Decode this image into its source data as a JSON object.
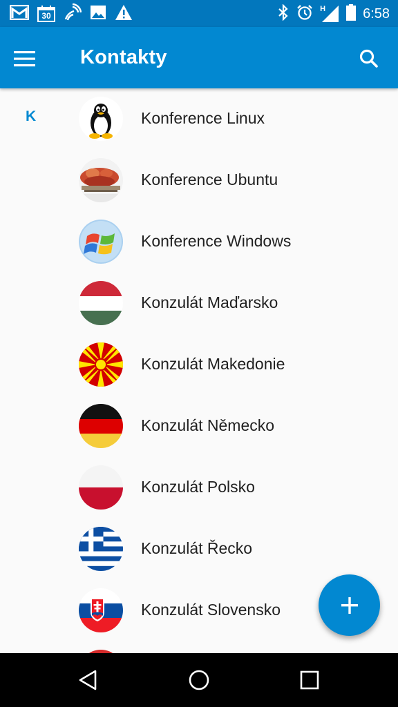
{
  "status_bar": {
    "time": "6:58",
    "calendar_day": "30",
    "network_label": "H",
    "left_icons": [
      "gmail-icon",
      "calendar-icon",
      "wifi-calling-icon",
      "image-icon",
      "warning-icon"
    ],
    "right_icons": [
      "bluetooth-icon",
      "alarm-icon",
      "signal-icon",
      "battery-icon"
    ]
  },
  "app_bar": {
    "title": "Kontakty",
    "menu_icon": "hamburger-menu-icon",
    "search_icon": "search-icon",
    "color": "#0288d1",
    "status_color": "#0277bd"
  },
  "contacts": {
    "section_letter": "K",
    "items": [
      {
        "name": "Konference Linux",
        "avatar": "tux-penguin"
      },
      {
        "name": "Konference Ubuntu",
        "avatar": "ubuntu-conference-photo"
      },
      {
        "name": "Konference Windows",
        "avatar": "windows-logo"
      },
      {
        "name": "Konzulát Maďarsko",
        "avatar": "flag-hungary"
      },
      {
        "name": "Konzulát Makedonie",
        "avatar": "flag-macedonia"
      },
      {
        "name": "Konzulát Německo",
        "avatar": "flag-germany"
      },
      {
        "name": "Konzulát Polsko",
        "avatar": "flag-poland"
      },
      {
        "name": "Konzulát Řecko",
        "avatar": "flag-greece"
      },
      {
        "name": "Konzulát Slovensko",
        "avatar": "flag-slovakia"
      }
    ]
  },
  "fab": {
    "icon": "plus-icon",
    "color": "#0288d1"
  },
  "nav_bar": {
    "icons": [
      "back-icon",
      "home-icon",
      "recents-icon"
    ]
  }
}
